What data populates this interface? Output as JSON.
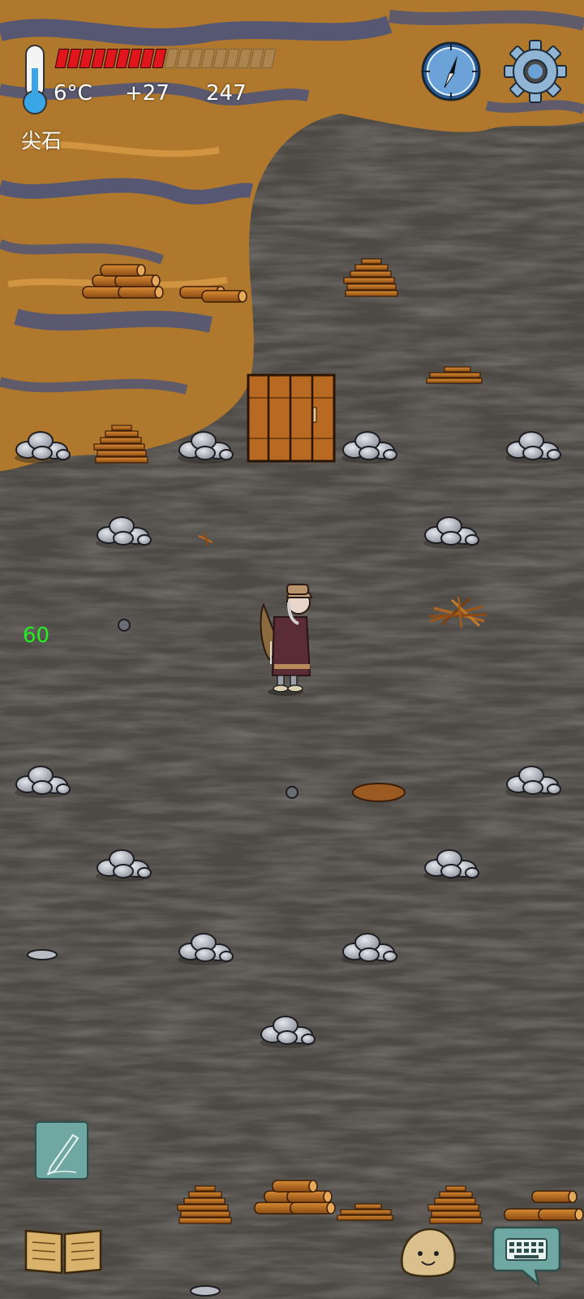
{
  "hud": {
    "temperature": "6°C",
    "food_bonus": "+27",
    "score": "247",
    "held_item": "尖石",
    "health_segments_filled": 9,
    "health_segments_total": 18,
    "health_color": "#e0161c"
  },
  "debug": {
    "fps": "60"
  },
  "buttons": {
    "compass": "compass-icon",
    "settings": "gear-icon",
    "note": "pencil-icon",
    "tech_book": "book-icon",
    "emote": "face-icon",
    "chat": "keyboard-icon"
  },
  "colors": {
    "ground": "#4a4642",
    "swamp_orange": "#b0782c",
    "swamp_blue": "#3e4f86",
    "wood": "#b5651d",
    "stone": "#b9bcc4",
    "door": "#b86a22",
    "ui_teal": "#6fa7a3"
  }
}
